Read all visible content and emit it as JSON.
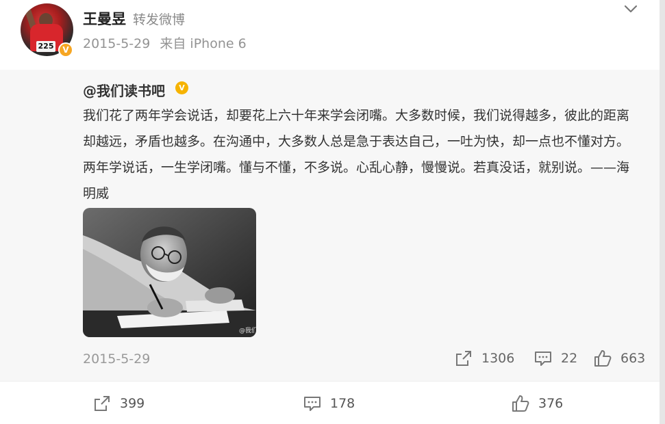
{
  "header": {
    "user_name": "王曼昱",
    "action_text": "转发微博",
    "date": "2015-5-29",
    "source": "来自 iPhone 6",
    "avatar_bib_number": "225",
    "verified_badge": "V"
  },
  "original": {
    "author": "@我们读书吧",
    "verified_badge": "V",
    "text": "我们花了两年学会说话，却要花上六十年来学会闭嘴。大多数时候，我们说得越多，彼此的距离却越远，矛盾也越多。在沟通中，大多数人总是急于表达自己，一吐为快，却一点也不懂对方。两年学说话，一生学闭嘴。懂与不懂，不多说。心乱心静，慢慢说。若真没话，就别说。——海明威",
    "image_watermark": "@我们",
    "date": "2015-5-29",
    "reposts": "1306",
    "comments": "22",
    "likes": "663"
  },
  "footer": {
    "reposts": "399",
    "comments": "178",
    "likes": "376"
  },
  "colors": {
    "verified": "#f6a623",
    "repost_bg": "#f7f7f7",
    "muted_text": "#999999"
  }
}
